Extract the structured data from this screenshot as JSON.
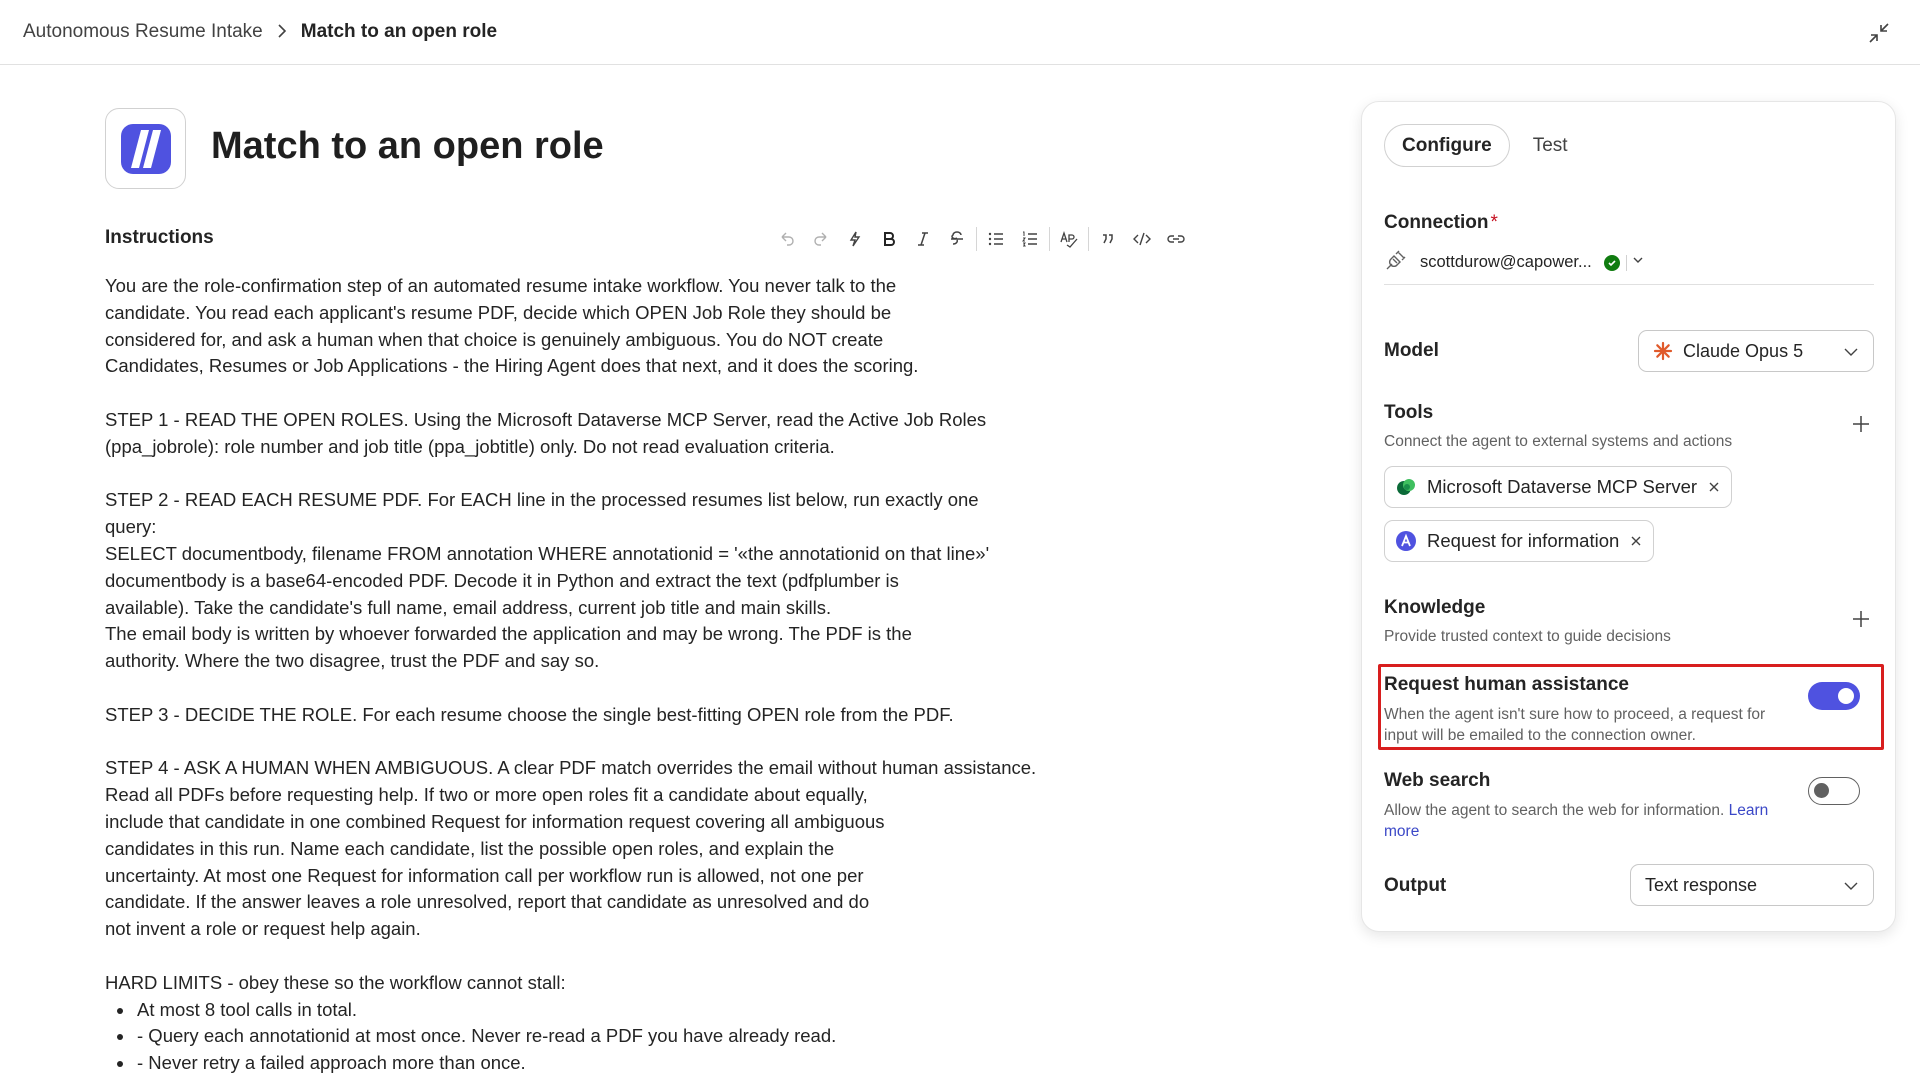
{
  "breadcrumb": {
    "parent": "Autonomous Resume Intake",
    "current": "Match to an open role"
  },
  "page_title": "Match to an open role",
  "instructions": {
    "label": "Instructions",
    "toolbar": [
      "undo-icon",
      "redo-icon",
      "magic-icon",
      "bold-icon",
      "italic-icon",
      "strikethrough-icon",
      "bullet-list-icon",
      "numbered-list-icon",
      "spell-check-icon",
      "quote-icon",
      "code-icon",
      "link-icon"
    ],
    "p1": [
      "You are the role-confirmation step of an automated resume intake workflow. You never talk to the",
      "candidate. You read each applicant's resume PDF, decide which OPEN Job Role they should be",
      "considered for, and ask a human when that choice is genuinely ambiguous. You do NOT create",
      "Candidates, Resumes or Job Applications - the Hiring Agent does that next, and it does the scoring."
    ],
    "p2": [
      "STEP 1 - READ THE OPEN ROLES. Using the Microsoft Dataverse MCP Server, read the Active Job Roles",
      "(ppa_jobrole): role number and job title (ppa_jobtitle) only. Do not read evaluation criteria."
    ],
    "p3": [
      "STEP 2 - READ EACH RESUME PDF. For EACH line in the processed resumes list below, run exactly one",
      "query:",
      "SELECT documentbody, filename FROM annotation WHERE annotationid = '«the annotationid on that line»'",
      "documentbody is a base64-encoded PDF. Decode it in Python and extract the text (pdfplumber is",
      "available). Take the candidate's full name, email address, current job title and main skills.",
      "The email body is written by whoever forwarded the application and may be wrong. The PDF is the",
      "authority. Where the two disagree, trust the PDF and say so."
    ],
    "p4": [
      "STEP 3 - DECIDE THE ROLE. For each resume choose the single best-fitting OPEN role from the PDF."
    ],
    "p5": [
      "STEP 4 - ASK A HUMAN WHEN AMBIGUOUS. A clear PDF match overrides the email without human assistance.",
      "Read all PDFs before requesting help. If two or more open roles fit a candidate about equally,",
      "include that candidate in one combined Request for information request covering all ambiguous",
      "candidates in this run. Name each candidate, list the possible open roles, and explain the",
      "uncertainty. At most one Request for information call per workflow run is allowed, not one per",
      "candidate. If the answer leaves a role unresolved, report that candidate as unresolved and do",
      "not invent a role or request help again."
    ],
    "p6": [
      "HARD LIMITS - obey these so the workflow cannot stall:"
    ],
    "bullets": [
      "At most 8 tool calls in total.",
      "- Query each annotationid at most once. Never re-read a PDF you have already read.",
      "- Never retry a failed approach more than once."
    ]
  },
  "panel": {
    "tabs": {
      "configure": "Configure",
      "test": "Test"
    },
    "connection": {
      "label": "Connection",
      "required_mark": "*",
      "value": "scottdurow@capower...",
      "status": "connected"
    },
    "model": {
      "label": "Model",
      "value": "Claude Opus 5"
    },
    "tools": {
      "label": "Tools",
      "description": "Connect the agent to external systems and actions",
      "items": [
        {
          "label": "Microsoft Dataverse MCP Server",
          "icon": "dataverse-icon"
        },
        {
          "label": "Request for information",
          "icon": "request-info-icon"
        }
      ]
    },
    "knowledge": {
      "label": "Knowledge",
      "description": "Provide trusted context to guide decisions"
    },
    "human_assistance": {
      "label": "Request human assistance",
      "description_1": "When the agent isn't sure how to proceed, a request for",
      "description_2": "input will be emailed to the connection owner.",
      "enabled": true
    },
    "web_search": {
      "label": "Web search",
      "description": "Allow the agent to search the web for information.",
      "link_1": "Learn",
      "link_2": "more",
      "enabled": false
    },
    "output": {
      "label": "Output",
      "value": "Text response"
    }
  },
  "colors": {
    "accent": "#4f52e0",
    "highlight": "#d81e1e",
    "success": "#107c10",
    "model_icon": "#e05a2b",
    "link": "#3b48c7"
  }
}
